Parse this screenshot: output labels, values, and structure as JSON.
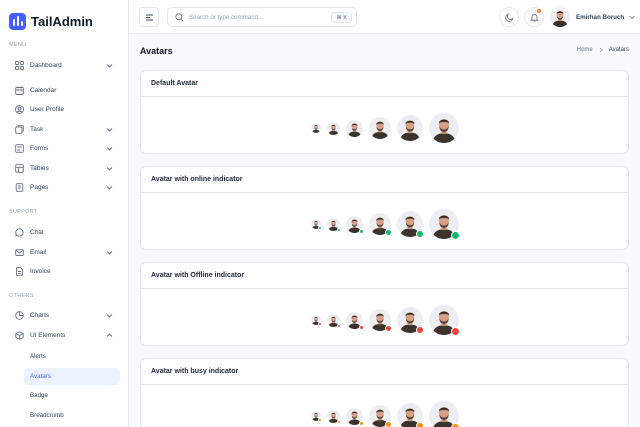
{
  "app": {
    "name": "TailAdmin"
  },
  "sidebar": {
    "sections": {
      "menu": "MENU",
      "support": "SUPPORT",
      "others": "OTHERS"
    },
    "items": [
      {
        "label": "Dashboard",
        "icon": "grid-icon"
      },
      {
        "label": "Calendar",
        "icon": "calendar-icon"
      },
      {
        "label": "User Profile",
        "icon": "user-icon"
      },
      {
        "label": "Task",
        "icon": "task-icon"
      },
      {
        "label": "Forms",
        "icon": "forms-icon"
      },
      {
        "label": "Tables",
        "icon": "tables-icon"
      },
      {
        "label": "Pages",
        "icon": "pages-icon"
      },
      {
        "label": "Chat",
        "icon": "chat-icon"
      },
      {
        "label": "Email",
        "icon": "mail-icon"
      },
      {
        "label": "Invoice",
        "icon": "invoice-icon"
      },
      {
        "label": "Charts",
        "icon": "pie-chart-icon"
      },
      {
        "label": "UI Elements",
        "icon": "box-icon"
      }
    ],
    "sub_items": [
      {
        "label": "Alerts"
      },
      {
        "label": "Avatars"
      },
      {
        "label": "Badge"
      },
      {
        "label": "Breadcrumb"
      }
    ]
  },
  "header": {
    "search_placeholder": "Search or type command...",
    "shortcut": "⌘ K",
    "user_name": "Emirhan Boruch"
  },
  "page": {
    "title": "Avatars",
    "breadcrumb": {
      "home": "Home",
      "current": "Avatars"
    }
  },
  "cards": [
    {
      "title": "Default Avatar",
      "indicator": "none"
    },
    {
      "title": "Avatar with online indicator",
      "indicator": "online"
    },
    {
      "title": "Avatar with Offline indicator",
      "indicator": "offline"
    },
    {
      "title": "Avatar with busy indicator",
      "indicator": "busy"
    }
  ],
  "colors": {
    "brand": "#465fff",
    "online": "#12b76a",
    "offline": "#f04438",
    "busy": "#f79009",
    "notification": "#fd853a"
  }
}
